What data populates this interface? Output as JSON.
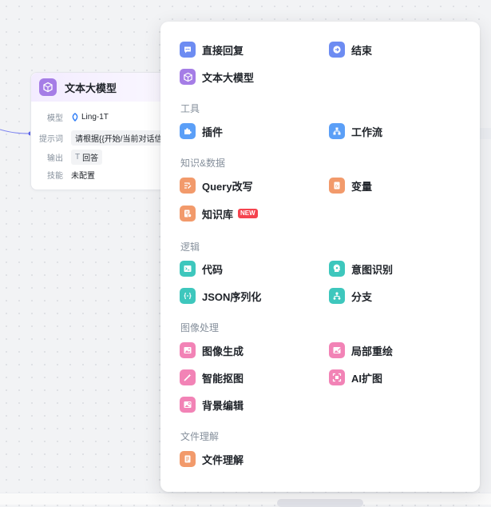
{
  "node": {
    "title": "文本大模型",
    "rows": [
      {
        "key": "模型",
        "value": "Ling-1T"
      },
      {
        "key": "提示词",
        "value": "请根据{{开始/当前对话信"
      },
      {
        "key": "输出",
        "value": "回答",
        "type_glyph": "T"
      },
      {
        "key": "技能",
        "value": "未配置"
      }
    ]
  },
  "menu": {
    "top": [
      {
        "label": "直接回复",
        "icon": "chat-bubble-icon",
        "color": "#6d8cf2"
      },
      {
        "label": "结束",
        "icon": "exit-arrow-icon",
        "color": "#6d8cf2"
      },
      {
        "label": "文本大模型",
        "icon": "cube-model-icon",
        "color": "#a57de6"
      }
    ],
    "sections": [
      {
        "title": "工具",
        "items": [
          {
            "label": "插件",
            "icon": "puzzle-icon",
            "color": "#5b9ff7"
          },
          {
            "label": "工作流",
            "icon": "workflow-tree-icon",
            "color": "#5b9ff7"
          }
        ]
      },
      {
        "title": "知识&数据",
        "items": [
          {
            "label": "Query改写",
            "icon": "query-rewrite-icon",
            "color": "#f29a6b"
          },
          {
            "label": "变量",
            "icon": "variable-fx-icon",
            "color": "#f29a6b"
          },
          {
            "label": "知识库",
            "icon": "knowledge-base-icon",
            "color": "#f29a6b",
            "badge": "NEW"
          }
        ]
      },
      {
        "title": "逻辑",
        "items": [
          {
            "label": "代码",
            "icon": "code-terminal-icon",
            "color": "#3ec7bd"
          },
          {
            "label": "意图识别",
            "icon": "intent-head-icon",
            "color": "#3ec7bd"
          },
          {
            "label": "JSON序列化",
            "icon": "json-braces-icon",
            "color": "#3ec7bd"
          },
          {
            "label": "分支",
            "icon": "branch-icon",
            "color": "#3ec7bd"
          }
        ]
      },
      {
        "title": "图像处理",
        "items": [
          {
            "label": "图像生成",
            "icon": "image-generate-icon",
            "color": "#f283b6"
          },
          {
            "label": "局部重绘",
            "icon": "image-inpaint-icon",
            "color": "#f283b6"
          },
          {
            "label": "智能抠图",
            "icon": "magic-wand-icon",
            "color": "#f283b6"
          },
          {
            "label": "AI扩图",
            "icon": "expand-frame-icon",
            "color": "#f283b6"
          },
          {
            "label": "背景编辑",
            "icon": "background-edit-icon",
            "color": "#f283b6"
          }
        ]
      },
      {
        "title": "文件理解",
        "items": [
          {
            "label": "文件理解",
            "icon": "document-icon",
            "color": "#f29a6b"
          }
        ]
      }
    ]
  }
}
